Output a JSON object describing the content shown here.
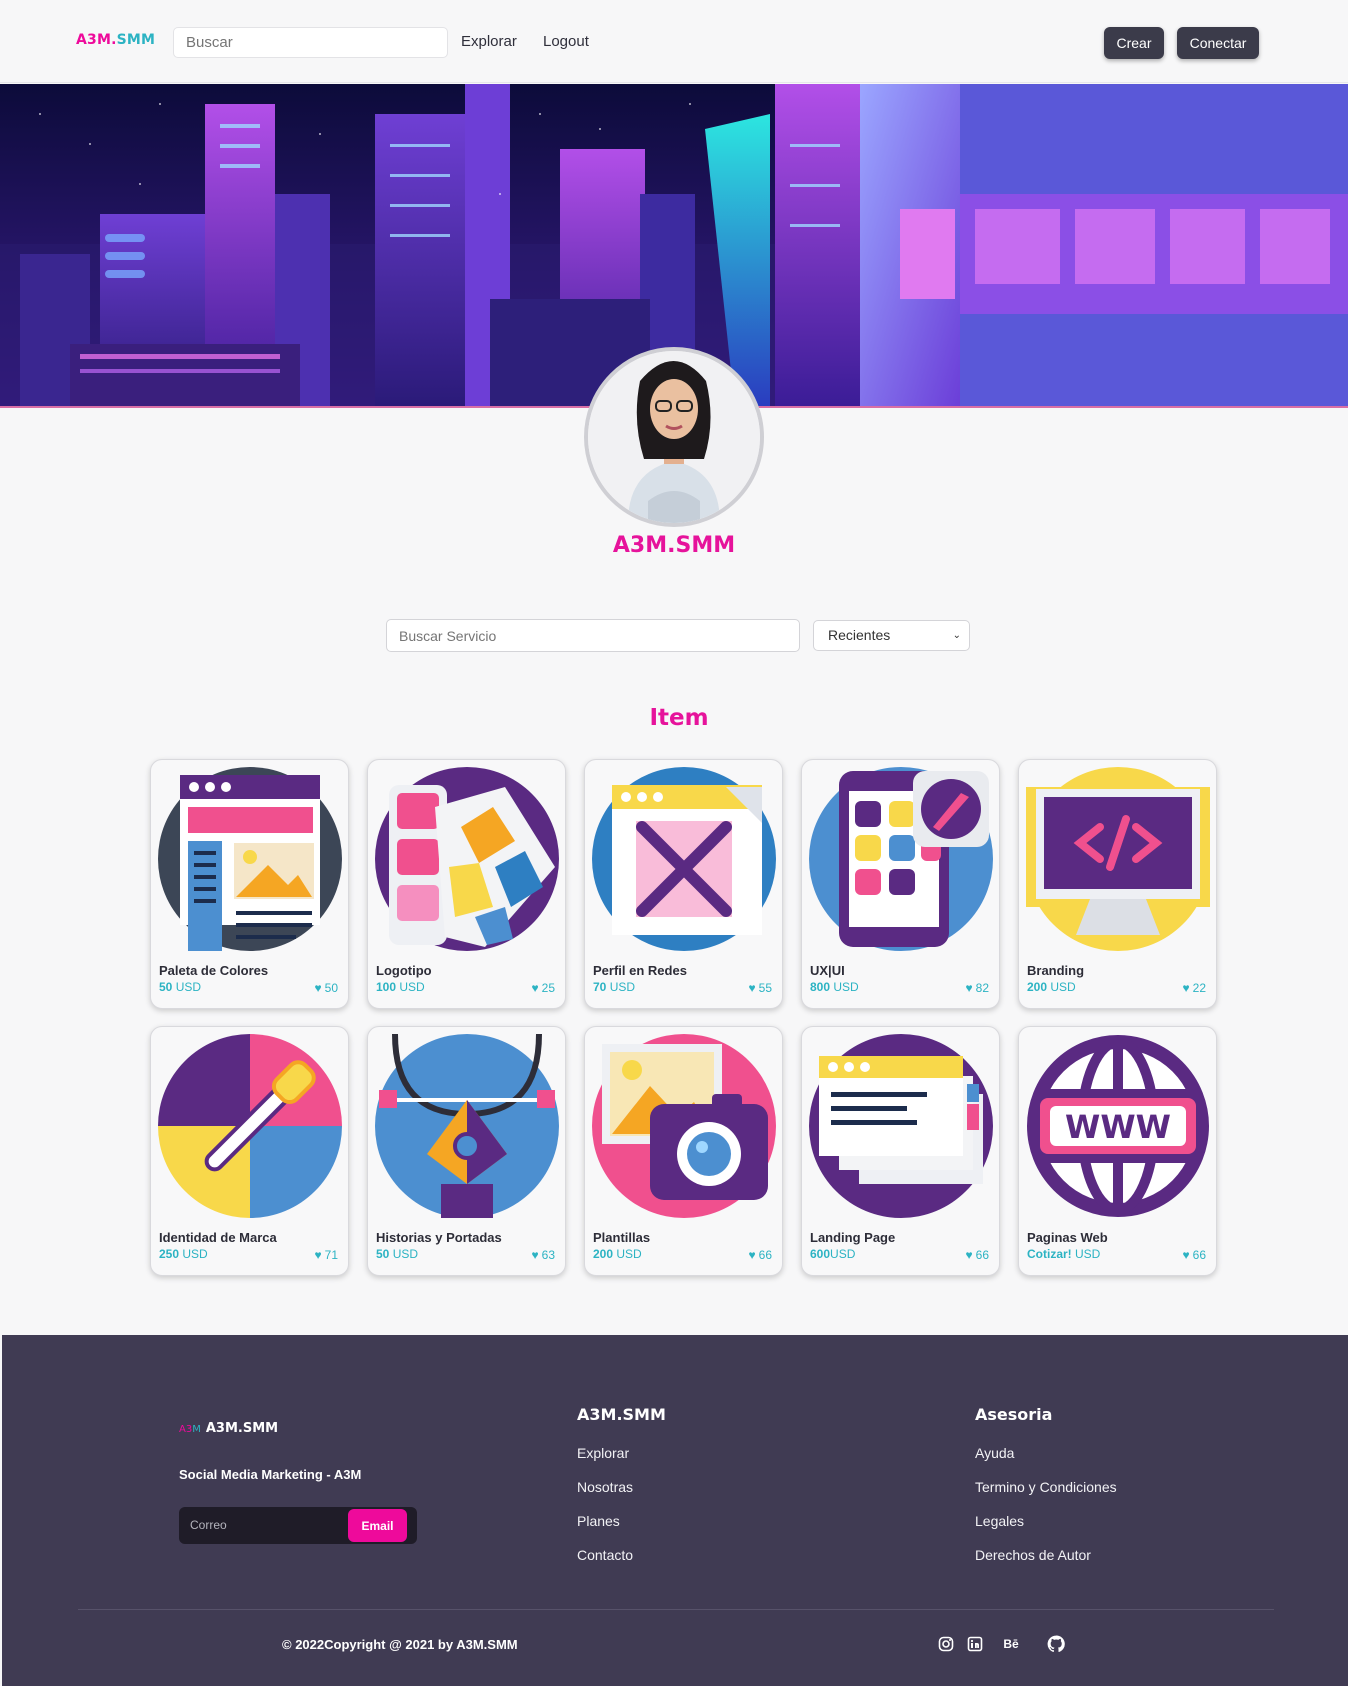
{
  "nav": {
    "logo_a": "A3M.",
    "logo_b": "SMM",
    "search_placeholder": "Buscar",
    "links": [
      "Explorar",
      "Logout"
    ],
    "buttons": [
      "Crear",
      "Conectar"
    ]
  },
  "profile": {
    "name": "A3M.SMM"
  },
  "filters": {
    "search_placeholder": "Buscar Servicio",
    "sort_selected": "Recientes"
  },
  "section": {
    "title": "Item"
  },
  "cards": [
    {
      "name": "Paleta de Colores",
      "price": "50",
      "unit": "USD",
      "likes": "50",
      "icon": "web-layout-icon"
    },
    {
      "name": "Logotipo",
      "price": "100",
      "unit": "USD",
      "likes": "25",
      "icon": "color-swatches-icon"
    },
    {
      "name": "Perfil en Redes",
      "price": "70",
      "unit": "USD",
      "likes": "55",
      "icon": "expand-window-icon"
    },
    {
      "name": "UX|UI",
      "price": "800",
      "unit": "USD",
      "likes": "82",
      "icon": "mobile-app-icon"
    },
    {
      "name": "Branding",
      "price": "200",
      "unit": "USD",
      "likes": "22",
      "icon": "code-monitor-icon"
    },
    {
      "name": "Identidad de Marca",
      "price": "250",
      "unit": "USD",
      "likes": "71",
      "icon": "color-picker-icon"
    },
    {
      "name": "Historias y Portadas",
      "price": "50",
      "unit": "USD",
      "likes": "63",
      "icon": "pen-tool-icon"
    },
    {
      "name": "Plantillas",
      "price": "200",
      "unit": "USD",
      "likes": "66",
      "icon": "camera-photo-icon"
    },
    {
      "name": "Landing Page",
      "price": "600",
      "unit": "USD",
      "likes": "66",
      "icon": "browser-windows-icon"
    },
    {
      "name": "Paginas Web",
      "price": "Cotizar!",
      "unit": "USD",
      "likes": "66",
      "icon": "www-globe-icon"
    }
  ],
  "footer": {
    "mini_logo_a": "A3",
    "mini_logo_b": "M",
    "brand": "A3M.SMM",
    "tagline": "Social Media Marketing - A3M",
    "email_placeholder": "Correo",
    "email_button": "Email",
    "col1_title": "A3M.SMM",
    "col1_links": [
      "Explorar",
      "Nosotras",
      "Planes",
      "Contacto"
    ],
    "col2_title": "Asesoria",
    "col2_links": [
      "Ayuda",
      "Termino y Condiciones",
      "Legales",
      "Derechos de Autor"
    ],
    "copyright": "© 2022Copyright @ 2021 by A3M.SMM",
    "behance": "Bē",
    "social_icons": [
      "instagram-icon",
      "linkedin-icon",
      "behance-icon",
      "github-icon"
    ]
  },
  "colors": {
    "accent_pink": "#ee0a9b",
    "accent_teal": "#2cb3c3",
    "footer_bg": "#403b53",
    "button_dark": "#3b3b4a"
  }
}
